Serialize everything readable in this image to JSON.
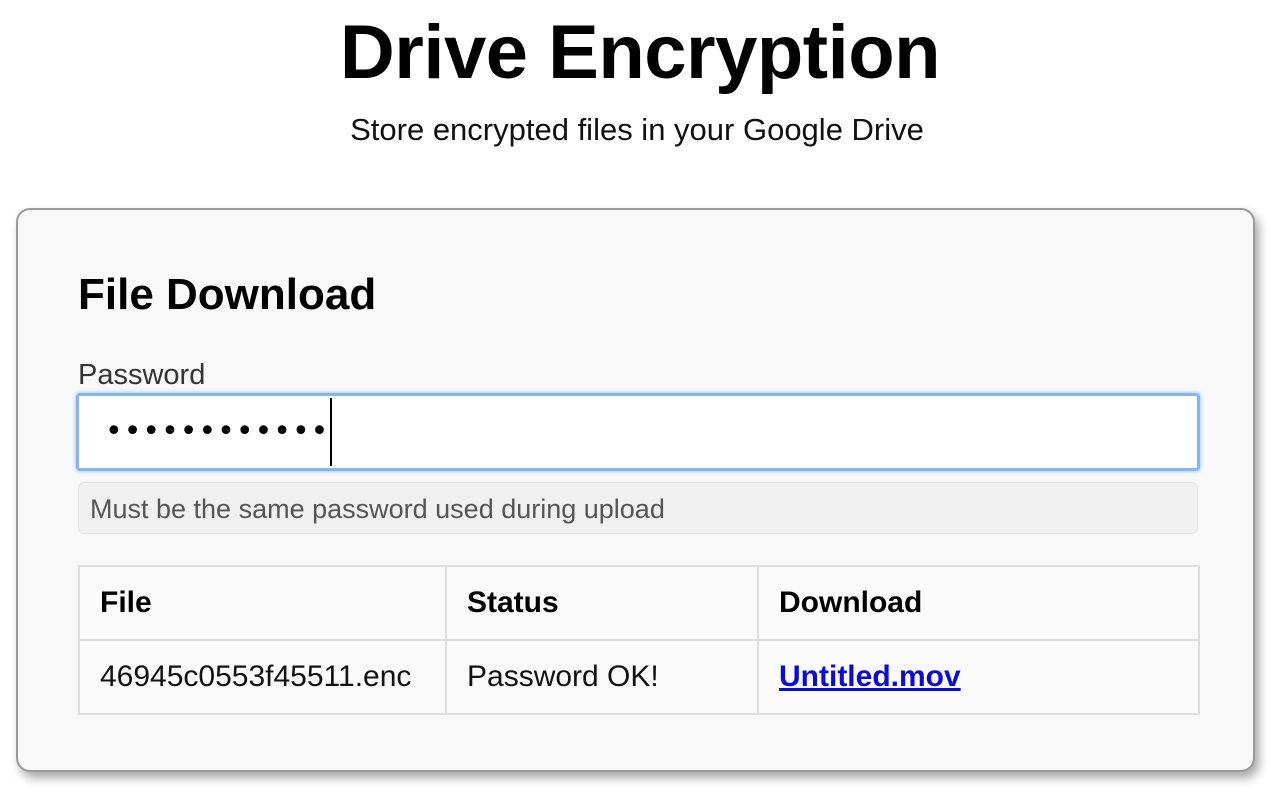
{
  "header": {
    "title": "Drive Encryption",
    "subtitle": "Store encrypted files in your Google Drive"
  },
  "panel": {
    "title": "File Download",
    "password": {
      "label": "Password",
      "masked_value": "••••••••••••",
      "help_text": "Must be the same password used during upload"
    },
    "table": {
      "headers": {
        "file": "File",
        "status": "Status",
        "download": "Download"
      },
      "rows": [
        {
          "file": "46945c0553f45511.enc",
          "status": "Password OK!",
          "download": "Untitled.mov"
        }
      ]
    }
  },
  "colors": {
    "link": "#0b0bd8",
    "focus_border": "#7fb6f3",
    "panel_background": "#f8f8f8"
  }
}
